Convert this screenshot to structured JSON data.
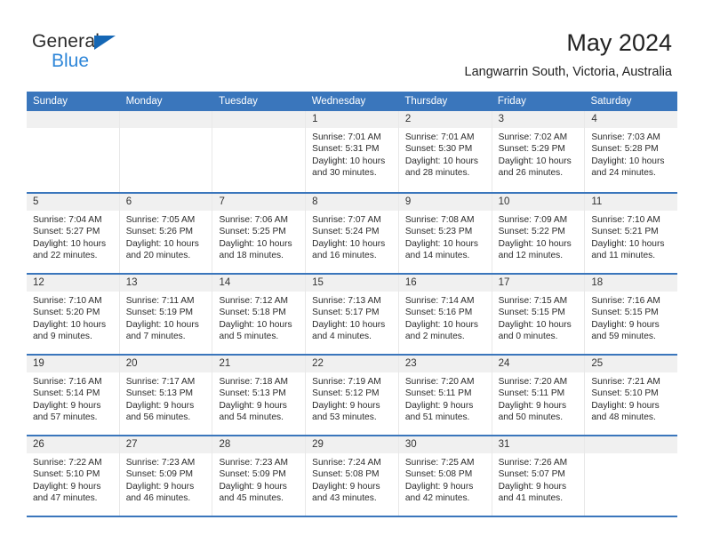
{
  "branding": {
    "logo_primary": "General",
    "logo_secondary": "Blue",
    "logo_mark": "blue-triangle-icon"
  },
  "header": {
    "title": "May 2024",
    "subtitle": "Langwarrin South, Victoria, Australia"
  },
  "colors": {
    "header_blue": "#3a76bc",
    "logo_blue": "#2e86d8",
    "day_band_gray": "#f0f0f0",
    "text": "#2b2b2b"
  },
  "weekdays": [
    "Sunday",
    "Monday",
    "Tuesday",
    "Wednesday",
    "Thursday",
    "Friday",
    "Saturday"
  ],
  "weeks": [
    [
      {
        "day": "",
        "sunrise": "",
        "sunset": "",
        "daylight_line1": "",
        "daylight_line2": "",
        "empty": true
      },
      {
        "day": "",
        "sunrise": "",
        "sunset": "",
        "daylight_line1": "",
        "daylight_line2": "",
        "empty": true
      },
      {
        "day": "",
        "sunrise": "",
        "sunset": "",
        "daylight_line1": "",
        "daylight_line2": "",
        "empty": true
      },
      {
        "day": "1",
        "sunrise": "Sunrise: 7:01 AM",
        "sunset": "Sunset: 5:31 PM",
        "daylight_line1": "Daylight: 10 hours",
        "daylight_line2": "and 30 minutes."
      },
      {
        "day": "2",
        "sunrise": "Sunrise: 7:01 AM",
        "sunset": "Sunset: 5:30 PM",
        "daylight_line1": "Daylight: 10 hours",
        "daylight_line2": "and 28 minutes."
      },
      {
        "day": "3",
        "sunrise": "Sunrise: 7:02 AM",
        "sunset": "Sunset: 5:29 PM",
        "daylight_line1": "Daylight: 10 hours",
        "daylight_line2": "and 26 minutes."
      },
      {
        "day": "4",
        "sunrise": "Sunrise: 7:03 AM",
        "sunset": "Sunset: 5:28 PM",
        "daylight_line1": "Daylight: 10 hours",
        "daylight_line2": "and 24 minutes."
      }
    ],
    [
      {
        "day": "5",
        "sunrise": "Sunrise: 7:04 AM",
        "sunset": "Sunset: 5:27 PM",
        "daylight_line1": "Daylight: 10 hours",
        "daylight_line2": "and 22 minutes."
      },
      {
        "day": "6",
        "sunrise": "Sunrise: 7:05 AM",
        "sunset": "Sunset: 5:26 PM",
        "daylight_line1": "Daylight: 10 hours",
        "daylight_line2": "and 20 minutes."
      },
      {
        "day": "7",
        "sunrise": "Sunrise: 7:06 AM",
        "sunset": "Sunset: 5:25 PM",
        "daylight_line1": "Daylight: 10 hours",
        "daylight_line2": "and 18 minutes."
      },
      {
        "day": "8",
        "sunrise": "Sunrise: 7:07 AM",
        "sunset": "Sunset: 5:24 PM",
        "daylight_line1": "Daylight: 10 hours",
        "daylight_line2": "and 16 minutes."
      },
      {
        "day": "9",
        "sunrise": "Sunrise: 7:08 AM",
        "sunset": "Sunset: 5:23 PM",
        "daylight_line1": "Daylight: 10 hours",
        "daylight_line2": "and 14 minutes."
      },
      {
        "day": "10",
        "sunrise": "Sunrise: 7:09 AM",
        "sunset": "Sunset: 5:22 PM",
        "daylight_line1": "Daylight: 10 hours",
        "daylight_line2": "and 12 minutes."
      },
      {
        "day": "11",
        "sunrise": "Sunrise: 7:10 AM",
        "sunset": "Sunset: 5:21 PM",
        "daylight_line1": "Daylight: 10 hours",
        "daylight_line2": "and 11 minutes."
      }
    ],
    [
      {
        "day": "12",
        "sunrise": "Sunrise: 7:10 AM",
        "sunset": "Sunset: 5:20 PM",
        "daylight_line1": "Daylight: 10 hours",
        "daylight_line2": "and 9 minutes."
      },
      {
        "day": "13",
        "sunrise": "Sunrise: 7:11 AM",
        "sunset": "Sunset: 5:19 PM",
        "daylight_line1": "Daylight: 10 hours",
        "daylight_line2": "and 7 minutes."
      },
      {
        "day": "14",
        "sunrise": "Sunrise: 7:12 AM",
        "sunset": "Sunset: 5:18 PM",
        "daylight_line1": "Daylight: 10 hours",
        "daylight_line2": "and 5 minutes."
      },
      {
        "day": "15",
        "sunrise": "Sunrise: 7:13 AM",
        "sunset": "Sunset: 5:17 PM",
        "daylight_line1": "Daylight: 10 hours",
        "daylight_line2": "and 4 minutes."
      },
      {
        "day": "16",
        "sunrise": "Sunrise: 7:14 AM",
        "sunset": "Sunset: 5:16 PM",
        "daylight_line1": "Daylight: 10 hours",
        "daylight_line2": "and 2 minutes."
      },
      {
        "day": "17",
        "sunrise": "Sunrise: 7:15 AM",
        "sunset": "Sunset: 5:15 PM",
        "daylight_line1": "Daylight: 10 hours",
        "daylight_line2": "and 0 minutes."
      },
      {
        "day": "18",
        "sunrise": "Sunrise: 7:16 AM",
        "sunset": "Sunset: 5:15 PM",
        "daylight_line1": "Daylight: 9 hours",
        "daylight_line2": "and 59 minutes."
      }
    ],
    [
      {
        "day": "19",
        "sunrise": "Sunrise: 7:16 AM",
        "sunset": "Sunset: 5:14 PM",
        "daylight_line1": "Daylight: 9 hours",
        "daylight_line2": "and 57 minutes."
      },
      {
        "day": "20",
        "sunrise": "Sunrise: 7:17 AM",
        "sunset": "Sunset: 5:13 PM",
        "daylight_line1": "Daylight: 9 hours",
        "daylight_line2": "and 56 minutes."
      },
      {
        "day": "21",
        "sunrise": "Sunrise: 7:18 AM",
        "sunset": "Sunset: 5:13 PM",
        "daylight_line1": "Daylight: 9 hours",
        "daylight_line2": "and 54 minutes."
      },
      {
        "day": "22",
        "sunrise": "Sunrise: 7:19 AM",
        "sunset": "Sunset: 5:12 PM",
        "daylight_line1": "Daylight: 9 hours",
        "daylight_line2": "and 53 minutes."
      },
      {
        "day": "23",
        "sunrise": "Sunrise: 7:20 AM",
        "sunset": "Sunset: 5:11 PM",
        "daylight_line1": "Daylight: 9 hours",
        "daylight_line2": "and 51 minutes."
      },
      {
        "day": "24",
        "sunrise": "Sunrise: 7:20 AM",
        "sunset": "Sunset: 5:11 PM",
        "daylight_line1": "Daylight: 9 hours",
        "daylight_line2": "and 50 minutes."
      },
      {
        "day": "25",
        "sunrise": "Sunrise: 7:21 AM",
        "sunset": "Sunset: 5:10 PM",
        "daylight_line1": "Daylight: 9 hours",
        "daylight_line2": "and 48 minutes."
      }
    ],
    [
      {
        "day": "26",
        "sunrise": "Sunrise: 7:22 AM",
        "sunset": "Sunset: 5:10 PM",
        "daylight_line1": "Daylight: 9 hours",
        "daylight_line2": "and 47 minutes."
      },
      {
        "day": "27",
        "sunrise": "Sunrise: 7:23 AM",
        "sunset": "Sunset: 5:09 PM",
        "daylight_line1": "Daylight: 9 hours",
        "daylight_line2": "and 46 minutes."
      },
      {
        "day": "28",
        "sunrise": "Sunrise: 7:23 AM",
        "sunset": "Sunset: 5:09 PM",
        "daylight_line1": "Daylight: 9 hours",
        "daylight_line2": "and 45 minutes."
      },
      {
        "day": "29",
        "sunrise": "Sunrise: 7:24 AM",
        "sunset": "Sunset: 5:08 PM",
        "daylight_line1": "Daylight: 9 hours",
        "daylight_line2": "and 43 minutes."
      },
      {
        "day": "30",
        "sunrise": "Sunrise: 7:25 AM",
        "sunset": "Sunset: 5:08 PM",
        "daylight_line1": "Daylight: 9 hours",
        "daylight_line2": "and 42 minutes."
      },
      {
        "day": "31",
        "sunrise": "Sunrise: 7:26 AM",
        "sunset": "Sunset: 5:07 PM",
        "daylight_line1": "Daylight: 9 hours",
        "daylight_line2": "and 41 minutes."
      },
      {
        "day": "",
        "sunrise": "",
        "sunset": "",
        "daylight_line1": "",
        "daylight_line2": "",
        "empty": true
      }
    ]
  ]
}
